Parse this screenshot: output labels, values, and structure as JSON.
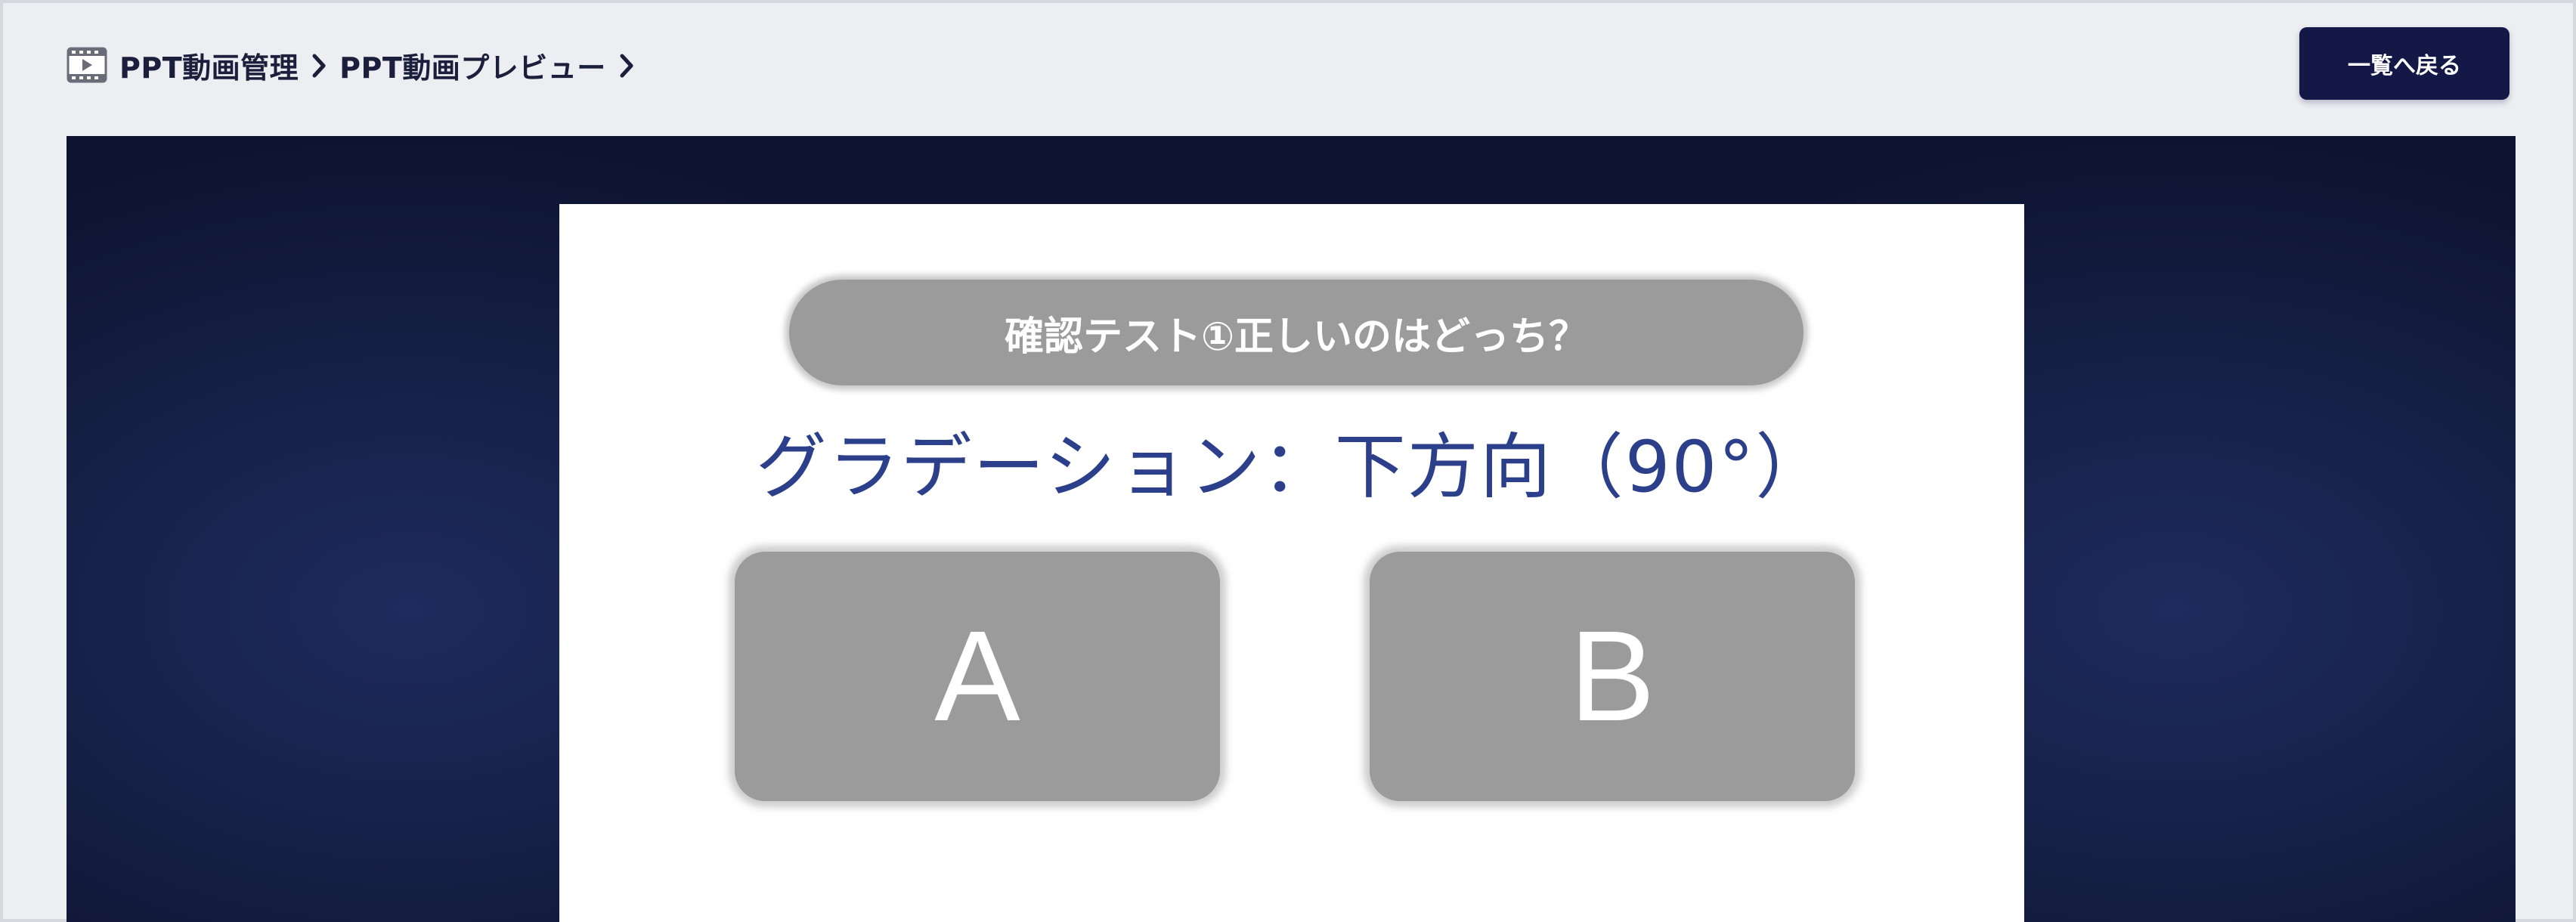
{
  "breadcrumb": {
    "icon": "film-icon",
    "items": [
      "PPT動画管理",
      "PPT動画プレビュー"
    ]
  },
  "header": {
    "back_button_label": "一覧へ戻る"
  },
  "slide": {
    "question": "確認テスト①正しいのはどっち？",
    "subtitle": "グラデーション：下方向（90°）",
    "choices": [
      "A",
      "B"
    ]
  },
  "colors": {
    "page_bg": "#edeef2",
    "button_bg": "#141846",
    "stage_bg": "#0e1430",
    "subtitle_text": "#2b3f8a",
    "choice_bg": "#9b9b9b"
  }
}
